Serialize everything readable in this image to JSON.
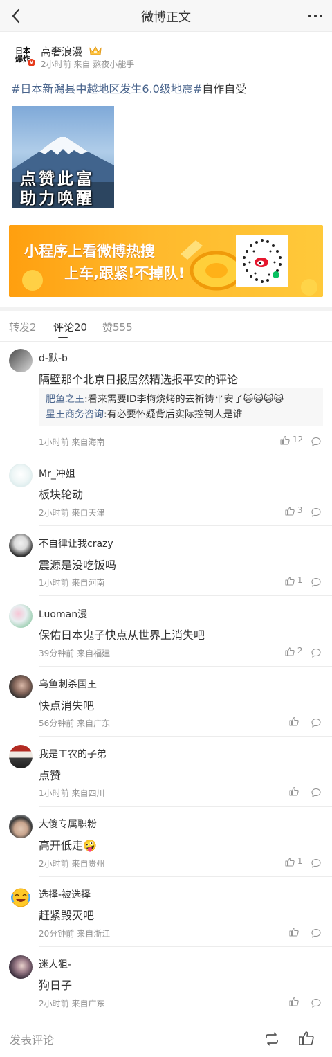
{
  "topbar": {
    "title": "微博正文"
  },
  "post": {
    "logo_line1": "日本",
    "logo_line2": "爆炸",
    "verified_mark": "v",
    "author": "高奢浪漫",
    "meta": "2小时前 来自 熬夜小能手",
    "hashtag": "#日本新潟县中越地区发生6.0级地震#",
    "text_after": "自作自受",
    "image_caption_line1": "点赞此富",
    "image_caption_line2": "助力唤醒",
    "banner_line1": "小程序上看微博热搜",
    "banner_line2": "上车,跟紧!不掉队!"
  },
  "tabs": [
    {
      "label": "转发2"
    },
    {
      "label": "评论20",
      "active": true
    },
    {
      "label": "赞555"
    }
  ],
  "comments": [
    {
      "name": "d-默-b",
      "text": "隔壁那个北京日报居然精选报平安的评论",
      "time": "1小时前 来自海南",
      "likes": "12",
      "replies": [
        {
          "name": "肥鱼之王",
          "text": ":看来需要ID李梅烧烤的去祈祷平安了😺😺😺😺"
        },
        {
          "name": "星王商务咨询",
          "text": ":有必要怀疑背后实际控制人是谁"
        }
      ]
    },
    {
      "name": "Mr_冲姐",
      "text": "板块轮动",
      "time": "2小时前 来自天津",
      "likes": "3"
    },
    {
      "name": "不自律让我crazy",
      "text": "震源是没吃饭吗",
      "time": "1小时前 来自河南",
      "likes": "1"
    },
    {
      "name": "Luoman漫",
      "text": "保佑日本鬼子快点从世界上消失吧",
      "time": "39分钟前 来自福建",
      "likes": "2"
    },
    {
      "name": "乌鱼刺杀国王",
      "text": "快点消失吧",
      "time": "56分钟前 来自广东",
      "likes": ""
    },
    {
      "name": "我是工农的子弟",
      "text": "点赞",
      "time": "1小时前 来自四川",
      "likes": ""
    },
    {
      "name": "大傻专属职粉",
      "text": "高开低走🤪",
      "time": "2小时前 来自贵州",
      "likes": "1"
    },
    {
      "name": "选择-被选择",
      "text": "赶紧毁灭吧",
      "time": "20分钟前 来自浙江",
      "likes": ""
    },
    {
      "name": "迷人狙-",
      "text": "狗日子",
      "time": "2小时前 来自广东",
      "likes": ""
    }
  ],
  "bottombar": {
    "placeholder": "发表评论"
  }
}
